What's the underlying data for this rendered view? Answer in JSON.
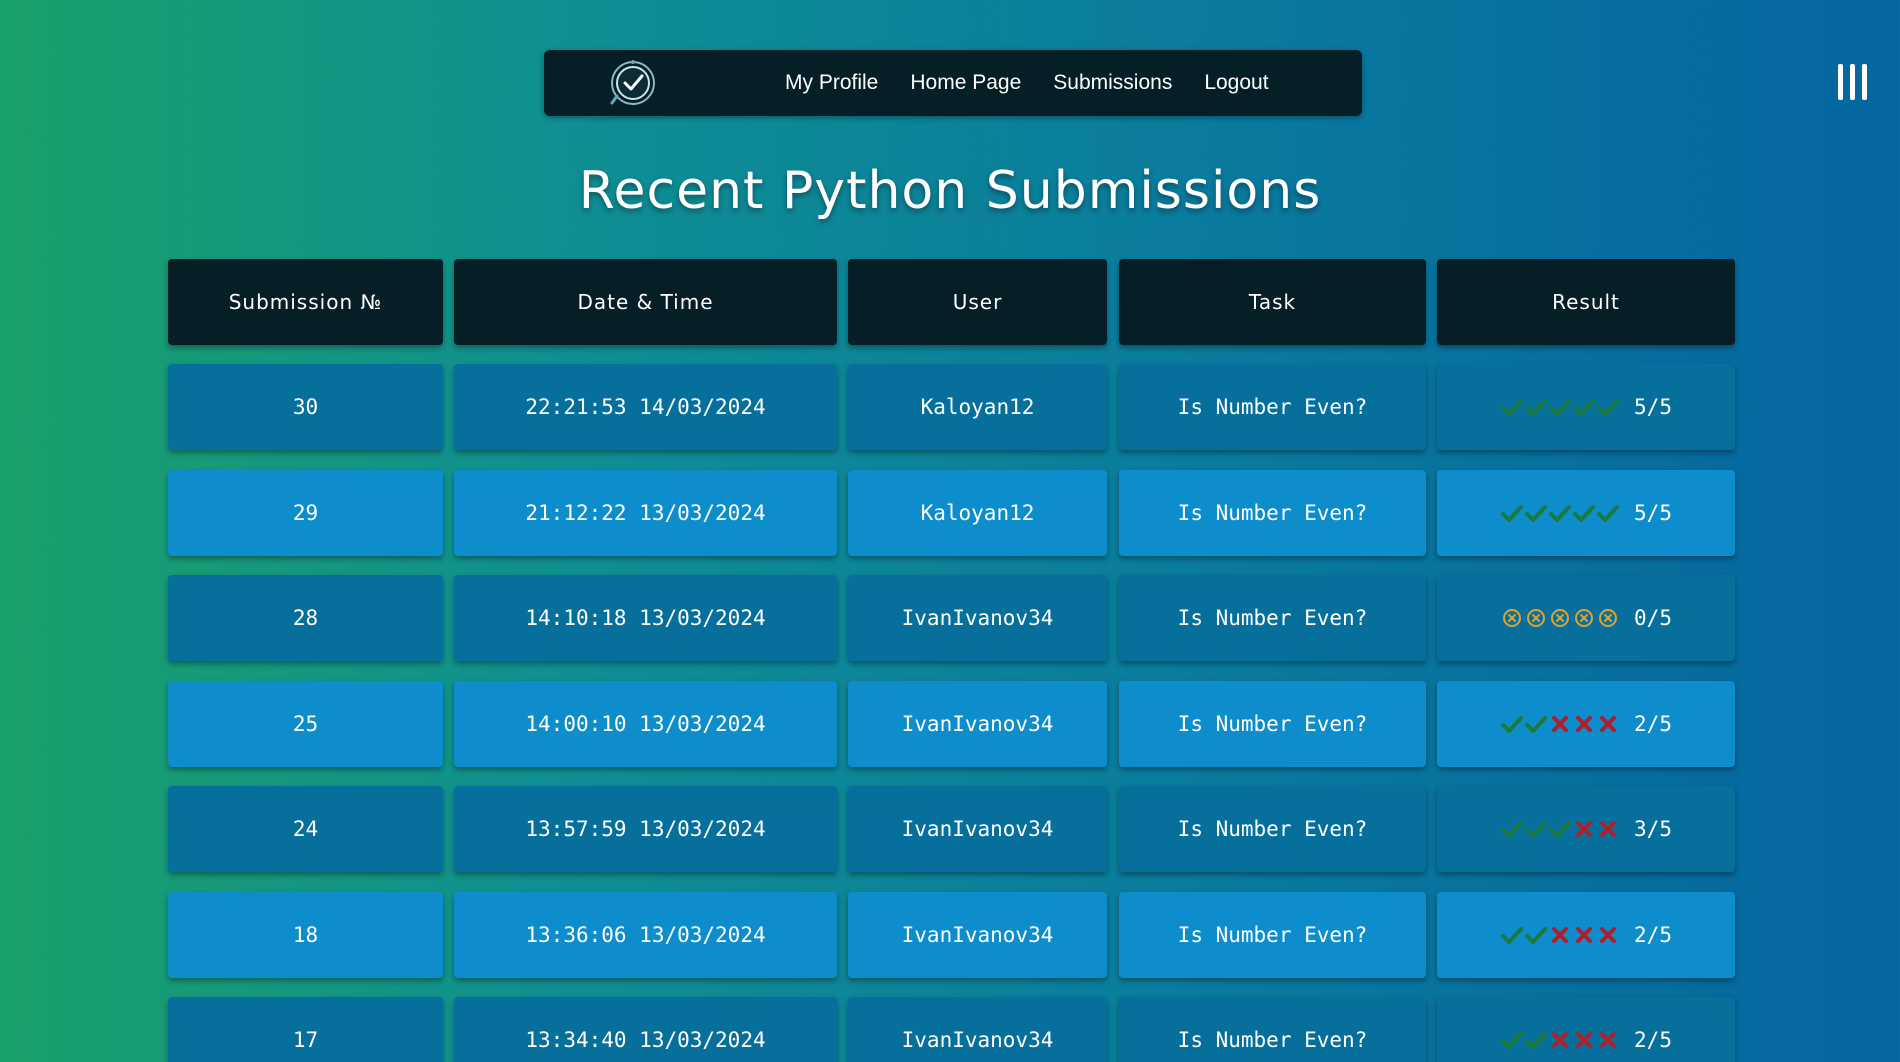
{
  "nav": {
    "links": [
      "My Profile",
      "Home Page",
      "Submissions",
      "Logout"
    ]
  },
  "icons": {
    "logo": "checkmark-shield-logo",
    "menu": "menu-icon",
    "pass": "check-icon",
    "fail": "cross-icon",
    "error": "circle-x-icon"
  },
  "colors": {
    "pass": "#1a7a3a",
    "fail": "#b01e2a",
    "error": "#e0a030",
    "header_bg": "#061e26"
  },
  "page": {
    "title": "Recent Python Submissions"
  },
  "table": {
    "columns": [
      "Submission №",
      "Date & Time",
      "User",
      "Task",
      "Result"
    ],
    "rows": [
      {
        "id": "30",
        "datetime": "22:21:53 14/03/2024",
        "user": "Kaloyan12",
        "task": "Is Number Even?",
        "marks": [
          "pass",
          "pass",
          "pass",
          "pass",
          "pass"
        ],
        "score": "5/5"
      },
      {
        "id": "29",
        "datetime": "21:12:22 13/03/2024",
        "user": "Kaloyan12",
        "task": "Is Number Even?",
        "marks": [
          "pass",
          "pass",
          "pass",
          "pass",
          "pass"
        ],
        "score": "5/5"
      },
      {
        "id": "28",
        "datetime": "14:10:18 13/03/2024",
        "user": "IvanIvanov34",
        "task": "Is Number Even?",
        "marks": [
          "error",
          "error",
          "error",
          "error",
          "error"
        ],
        "score": "0/5"
      },
      {
        "id": "25",
        "datetime": "14:00:10 13/03/2024",
        "user": "IvanIvanov34",
        "task": "Is Number Even?",
        "marks": [
          "pass",
          "pass",
          "fail",
          "fail",
          "fail"
        ],
        "score": "2/5"
      },
      {
        "id": "24",
        "datetime": "13:57:59 13/03/2024",
        "user": "IvanIvanov34",
        "task": "Is Number Even?",
        "marks": [
          "pass",
          "pass",
          "pass",
          "fail",
          "fail"
        ],
        "score": "3/5"
      },
      {
        "id": "18",
        "datetime": "13:36:06 13/03/2024",
        "user": "IvanIvanov34",
        "task": "Is Number Even?",
        "marks": [
          "pass",
          "pass",
          "fail",
          "fail",
          "fail"
        ],
        "score": "2/5"
      },
      {
        "id": "17",
        "datetime": "13:34:40 13/03/2024",
        "user": "IvanIvanov34",
        "task": "Is Number Even?",
        "marks": [
          "pass",
          "pass",
          "fail",
          "fail",
          "fail"
        ],
        "score": "2/5"
      }
    ]
  }
}
